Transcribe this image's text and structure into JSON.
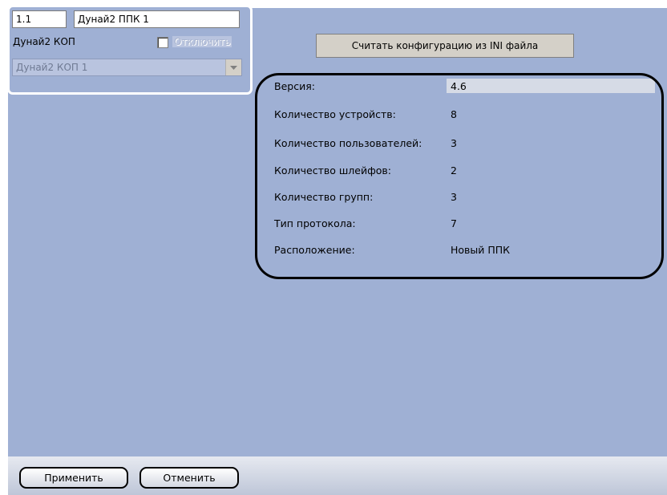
{
  "header": {
    "id_value": "1.1",
    "name_value": "Дунай2 ППК 1",
    "parent_label": "Дунай2 КОП",
    "disable_label": "Отключить",
    "parent_select_value": "Дунай2 КОП 1"
  },
  "read_ini_button": "Считать конфигурацию из INI файла",
  "info": [
    {
      "label": "Версия:",
      "value": "4.6"
    },
    {
      "label": "Количество устройств:",
      "value": "8"
    },
    {
      "label": "Количество пользователей:",
      "value": "3"
    },
    {
      "label": "Количество шлейфов:",
      "value": "2"
    },
    {
      "label": "Количество групп:",
      "value": "3"
    },
    {
      "label": "Тип протокола:",
      "value": "7"
    },
    {
      "label": "Расположение:",
      "value": "Новый ППК"
    }
  ],
  "footer": {
    "apply_label": "Применить",
    "cancel_label": "Отменить"
  }
}
